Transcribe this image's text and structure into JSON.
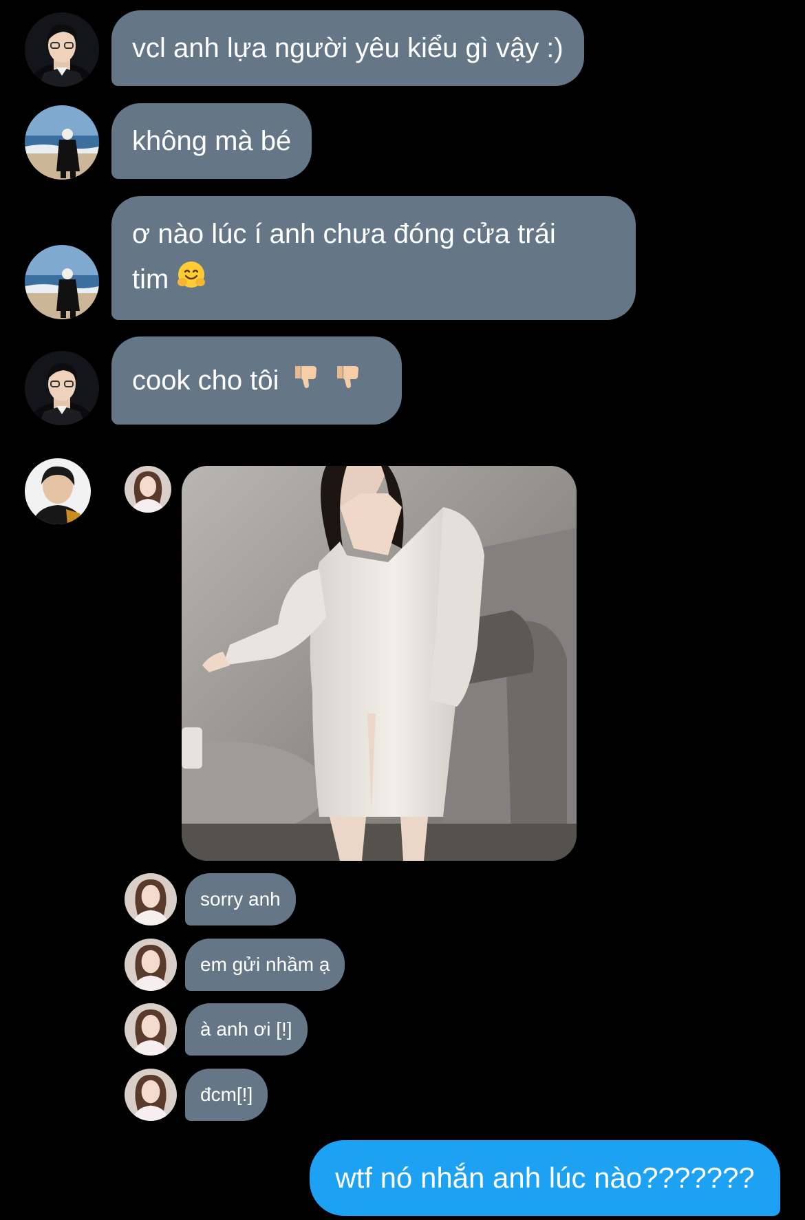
{
  "messages": [
    {
      "text": "vcl anh lựa người yêu kiểu gì vậy :)"
    },
    {
      "text": "không mà bé"
    },
    {
      "text_line1": "ơ nào lúc í anh chưa đóng cửa trái",
      "text_line2": "tim",
      "emoji": "hugging-face-icon"
    },
    {
      "text": "cook cho tôi",
      "emoji": "thumbs-down-icon"
    }
  ],
  "forwarded": {
    "image": "white-dress-photo",
    "replies": [
      "sorry anh",
      "em gửi nhầm ạ",
      "à anh ơi [!]",
      "đcm[!]"
    ]
  },
  "outgoing": {
    "text": "wtf nó nhắn anh lúc nào???????"
  },
  "colors": {
    "background": "#000000",
    "incoming_bubble": "#657786",
    "outgoing_bubble": "#1da1f2",
    "text": "#ffffff"
  }
}
